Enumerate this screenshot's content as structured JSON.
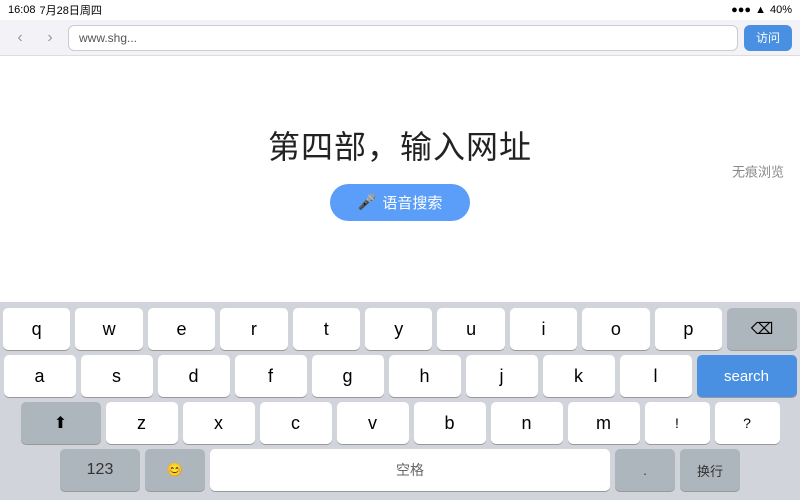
{
  "statusBar": {
    "time": "16:08",
    "date": "7月28日周四",
    "signal": "●●●",
    "wifi": "WiFi",
    "battery": "40%"
  },
  "browserToolbar": {
    "urlPlaceholder": "www.shg...",
    "visitButton": "访问",
    "backIcon": "‹",
    "forwardIcon": "›"
  },
  "pageContent": {
    "title": "第四部，输入网址",
    "voiceSearchLabel": "语音搜索",
    "micIcon": "🎤",
    "incognitoLabel": "无痕浏览"
  },
  "keyboard": {
    "row1": [
      "q",
      "w",
      "e",
      "r",
      "t",
      "y",
      "u",
      "i",
      "o",
      "p"
    ],
    "row2": [
      "a",
      "s",
      "d",
      "f",
      "g",
      "h",
      "j",
      "k",
      "l"
    ],
    "row3": [
      "z",
      "x",
      "c",
      "v",
      "b",
      "n",
      "m"
    ],
    "searchLabel": "search",
    "backspaceIcon": "⌫",
    "shiftIcon": "⬆",
    "moreIcon": "123",
    "spaceLabel": "空格",
    "questionMark": "?"
  }
}
